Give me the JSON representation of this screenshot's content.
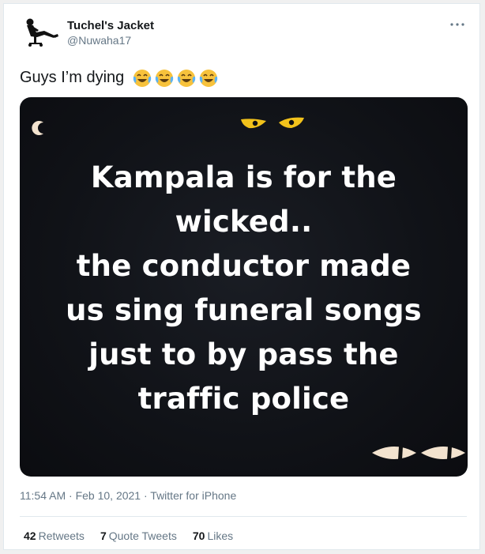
{
  "author": {
    "display_name": "Tuchel's Jacket",
    "handle": "@Nuwaha17"
  },
  "more_icon": "more-options-icon",
  "tweet": {
    "text": "Guys I’m dying",
    "emojis": [
      "face-with-tears-of-joy",
      "face-with-tears-of-joy",
      "face-with-tears-of-joy",
      "face-with-tears-of-joy"
    ]
  },
  "media": {
    "lines": [
      "Kampala is for the",
      "wicked..",
      "the conductor made",
      "us sing funeral songs",
      "just to by pass the",
      "traffic police"
    ],
    "background_color": "#101217"
  },
  "meta": {
    "time": "11:54 AM",
    "separator": "·",
    "date": "Feb 10, 2021",
    "source": "Twitter for iPhone"
  },
  "stats": {
    "retweets_count": "42",
    "retweets_label": "Retweets",
    "quotes_count": "7",
    "quotes_label": "Quote Tweets",
    "likes_count": "70",
    "likes_label": "Likes"
  },
  "colors": {
    "text_primary": "#14171a",
    "text_secondary": "#657786",
    "border": "#e1e8ed",
    "emoji_yellow": "#f7c23c"
  }
}
